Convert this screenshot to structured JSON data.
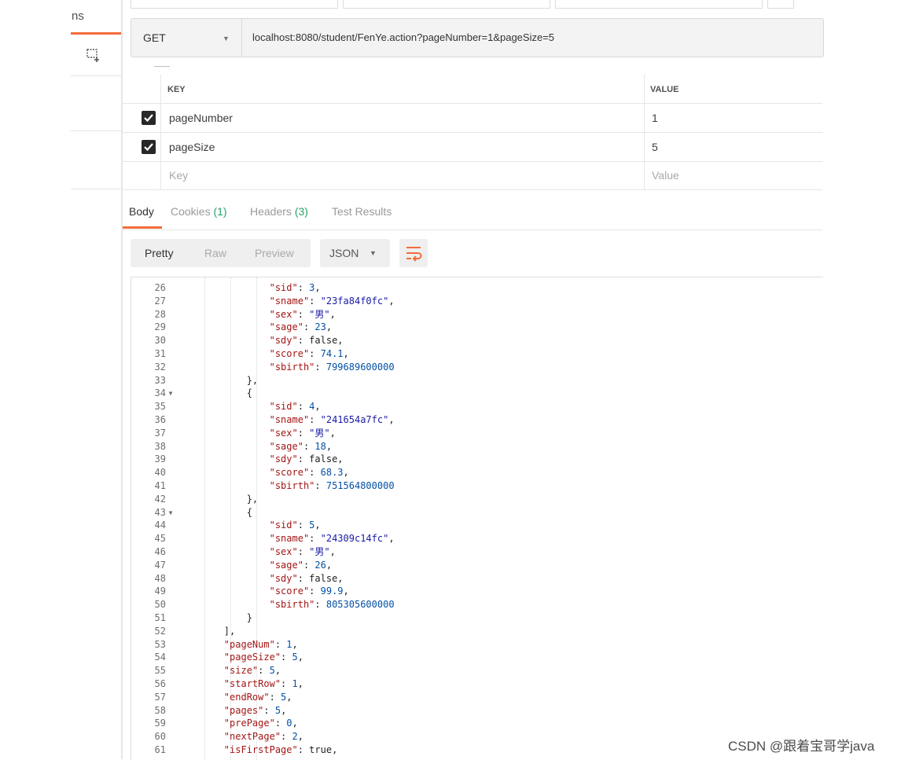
{
  "sidebar": {
    "tab_fragment": "ns",
    "new_icon": "new-window-icon"
  },
  "request": {
    "method": "GET",
    "url": "localhost:8080/student/FenYe.action?pageNumber=1&pageSize=5"
  },
  "params": {
    "headers": {
      "key": "KEY",
      "value": "VALUE"
    },
    "rows": [
      {
        "checked": true,
        "key": "pageNumber",
        "value": "1"
      },
      {
        "checked": true,
        "key": "pageSize",
        "value": "5"
      }
    ],
    "placeholder": {
      "key": "Key",
      "value": "Value"
    }
  },
  "response_tabs": {
    "body": "Body",
    "cookies": "Cookies",
    "cookies_count": "(1)",
    "headers": "Headers",
    "headers_count": "(3)",
    "tests": "Test Results"
  },
  "view": {
    "pretty": "Pretty",
    "raw": "Raw",
    "preview": "Preview",
    "format": "JSON",
    "wrap_icon": "wrap-lines-icon"
  },
  "code_lines": [
    {
      "n": "26",
      "t": "                \"sid\": 3,"
    },
    {
      "n": "27",
      "t": "                \"sname\": \"23fa84f0fc\","
    },
    {
      "n": "28",
      "t": "                \"sex\": \"男\","
    },
    {
      "n": "29",
      "t": "                \"sage\": 23,"
    },
    {
      "n": "30",
      "t": "                \"sdy\": false,"
    },
    {
      "n": "31",
      "t": "                \"score\": 74.1,"
    },
    {
      "n": "32",
      "t": "                \"sbirth\": 799689600000"
    },
    {
      "n": "33",
      "t": "            },"
    },
    {
      "n": "34",
      "t": "            {",
      "fold": true
    },
    {
      "n": "35",
      "t": "                \"sid\": 4,"
    },
    {
      "n": "36",
      "t": "                \"sname\": \"241654a7fc\","
    },
    {
      "n": "37",
      "t": "                \"sex\": \"男\","
    },
    {
      "n": "38",
      "t": "                \"sage\": 18,"
    },
    {
      "n": "39",
      "t": "                \"sdy\": false,"
    },
    {
      "n": "40",
      "t": "                \"score\": 68.3,"
    },
    {
      "n": "41",
      "t": "                \"sbirth\": 751564800000"
    },
    {
      "n": "42",
      "t": "            },"
    },
    {
      "n": "43",
      "t": "            {",
      "fold": true
    },
    {
      "n": "44",
      "t": "                \"sid\": 5,"
    },
    {
      "n": "45",
      "t": "                \"sname\": \"24309c14fc\","
    },
    {
      "n": "46",
      "t": "                \"sex\": \"男\","
    },
    {
      "n": "47",
      "t": "                \"sage\": 26,"
    },
    {
      "n": "48",
      "t": "                \"sdy\": false,"
    },
    {
      "n": "49",
      "t": "                \"score\": 99.9,"
    },
    {
      "n": "50",
      "t": "                \"sbirth\": 805305600000"
    },
    {
      "n": "51",
      "t": "            }"
    },
    {
      "n": "52",
      "t": "        ],"
    },
    {
      "n": "53",
      "t": "        \"pageNum\": 1,"
    },
    {
      "n": "54",
      "t": "        \"pageSize\": 5,"
    },
    {
      "n": "55",
      "t": "        \"size\": 5,"
    },
    {
      "n": "56",
      "t": "        \"startRow\": 1,"
    },
    {
      "n": "57",
      "t": "        \"endRow\": 5,"
    },
    {
      "n": "58",
      "t": "        \"pages\": 5,"
    },
    {
      "n": "59",
      "t": "        \"prePage\": 0,"
    },
    {
      "n": "60",
      "t": "        \"nextPage\": 2,"
    },
    {
      "n": "61",
      "t": "        \"isFirstPage\": true,"
    }
  ],
  "watermark": "CSDN @跟着宝哥学java"
}
